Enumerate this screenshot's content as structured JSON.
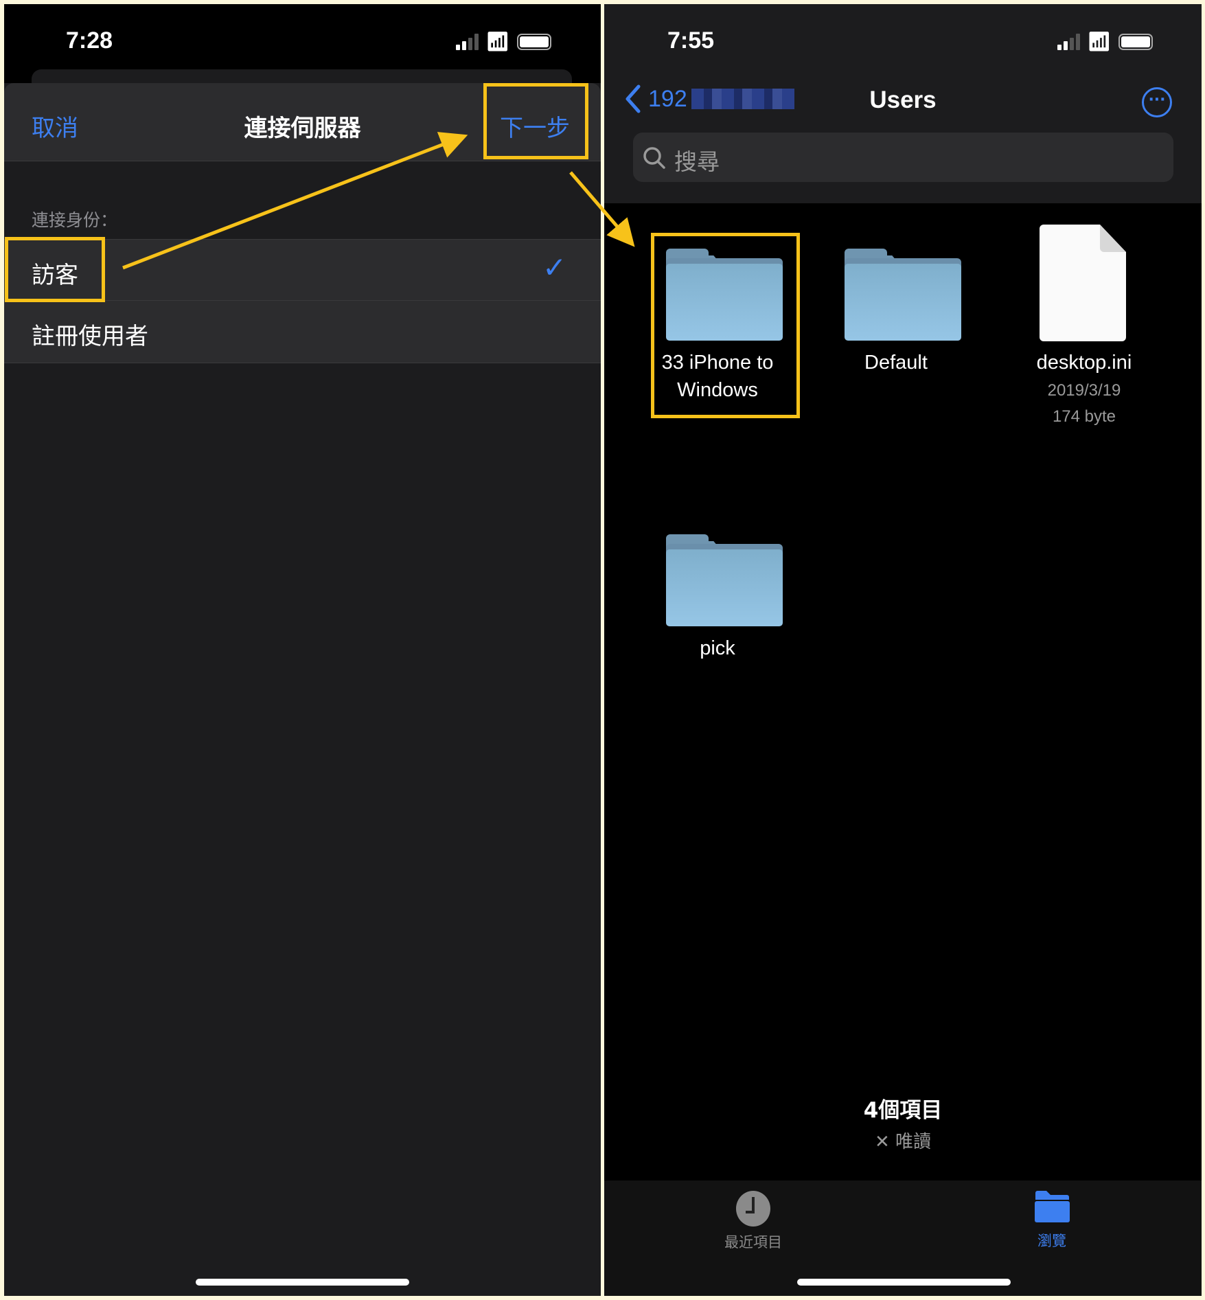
{
  "left_screen": {
    "status_time": "7:28",
    "nav": {
      "cancel": "取消",
      "title": "連接伺服器",
      "next": "下一步"
    },
    "section_label": "連接身份：",
    "options": [
      {
        "label": "訪客",
        "selected": true
      },
      {
        "label": "註冊使用者",
        "selected": false
      }
    ]
  },
  "right_screen": {
    "status_time": "7:55",
    "nav": {
      "back_label": "192",
      "title": "Users"
    },
    "search": {
      "placeholder": "搜尋"
    },
    "items": [
      {
        "name": "33 iPhone to Windows",
        "line1": "33 iPhone to",
        "line2": "Windows",
        "type": "folder"
      },
      {
        "name": "Default",
        "type": "folder"
      },
      {
        "name": "desktop.ini",
        "type": "file",
        "date": "2019/3/19",
        "size": "174 byte"
      },
      {
        "name": "pick",
        "type": "folder"
      }
    ],
    "footer": {
      "count": "4個項目",
      "readonly": "唯讀"
    },
    "tabs": [
      {
        "label": "最近項目",
        "icon": "clock-icon",
        "active": false
      },
      {
        "label": "瀏覽",
        "icon": "folder-icon",
        "active": true
      }
    ]
  },
  "colors": {
    "accent": "#3d7ff0",
    "highlight": "#f7c21a"
  }
}
